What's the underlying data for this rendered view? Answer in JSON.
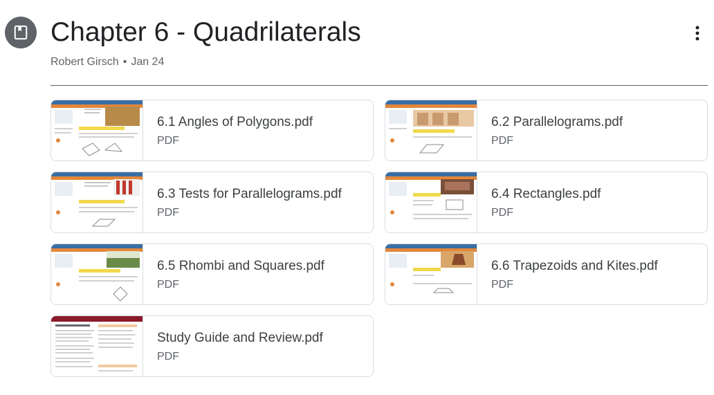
{
  "post": {
    "title": "Chapter 6 - Quadrilaterals",
    "author": "Robert Girsch",
    "separator": "•",
    "date": "Jan 24",
    "icon": "material-icon",
    "menu_icon": "more-vert-icon"
  },
  "colors": {
    "icon_bg": "#5f6368",
    "divider": "#5f6368",
    "card_border": "#dadce0",
    "title": "#202124",
    "secondary_text": "#5f6368"
  },
  "attachments": [
    {
      "name": "6.1 Angles of Polygons.pdf",
      "type": "PDF",
      "thumb": "page-thumbnail"
    },
    {
      "name": "6.2 Parallelograms.pdf",
      "type": "PDF",
      "thumb": "page-thumbnail"
    },
    {
      "name": "6.3 Tests for Parallelograms.pdf",
      "type": "PDF",
      "thumb": "page-thumbnail"
    },
    {
      "name": "6.4 Rectangles.pdf",
      "type": "PDF",
      "thumb": "page-thumbnail"
    },
    {
      "name": "6.5 Rhombi and Squares.pdf",
      "type": "PDF",
      "thumb": "page-thumbnail"
    },
    {
      "name": "6.6 Trapezoids and Kites.pdf",
      "type": "PDF",
      "thumb": "page-thumbnail"
    },
    {
      "name": "Study Guide and Review.pdf",
      "type": "PDF",
      "thumb": "page-thumbnail"
    }
  ]
}
